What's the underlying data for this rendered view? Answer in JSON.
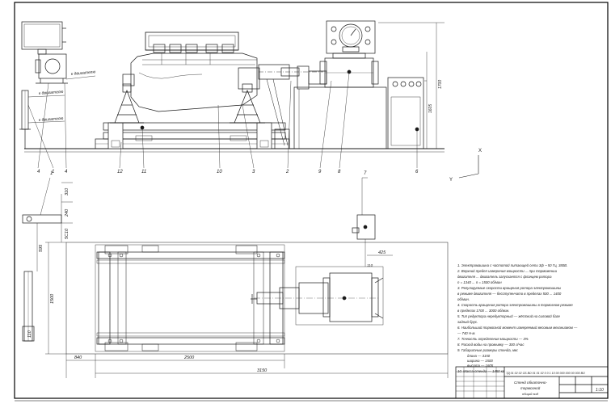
{
  "sheet": {
    "border_color": "#000000",
    "line_color": "#1a1a1a",
    "thin_color": "#555555"
  },
  "callouts": [
    "4",
    "1",
    "4",
    "12",
    "11",
    "10",
    "3",
    "2",
    "9",
    "8",
    "6",
    "7"
  ],
  "top_view_callouts": [
    "1",
    "7"
  ],
  "leader_notes": [
    "к двигателю",
    "к двигателю",
    "к двигателю"
  ],
  "dims": {
    "front_width": "1700",
    "front_height": "1605",
    "plan_total": "3150",
    "plan_frame": "2500",
    "plan_left": "840",
    "plan_depth": "1500",
    "top_small_a": "310",
    "top_small_b": "240",
    "top_small_c": "5С10",
    "left_small": "595",
    "left_block": "110",
    "right_small": "425",
    "right_small2": "110"
  },
  "axes": {
    "x": "X",
    "y": "Y"
  },
  "notes": [
    "1. Электромашина с частотой питающей сети 3ф ~ 50 Гц, 380В.",
    "2. Верхний предел измерения мощности ... при торможении",
    "двигателя ... двигатель запускается с фланцем ротора",
    "n = 1340 ... n = 1500 об/мин",
    "3. Регулируемые скорости вращения ротора электромашины",
    "в режиме двигателя — бесступенчато в пределах 500 ... 1400",
    "об/мин.",
    "4. Скорость вращения ротора электромашины в тормозном режиме",
    "в пределах 1700 ... 3000 об/мин.",
    "5. Тип редуктора нередукторный — жёсткий на силовой базе",
    "задний брус.",
    "6. Наибольший тормозной момент измеряемый весовым механизмом —",
    "— 740 Н·м.",
    "7. Точность определения мощности — 3%",
    "8. Расход воды на промывку — 300 л/час",
    "9. Габаритные размеры стенда, мм:",
    "длина — 3150",
    "ширина — 1500",
    "высота — 1605",
    "10. Масса стенда — 1450 кг"
  ],
  "title_block": {
    "code": "ТД 01 02 02 СБ ВО 01 01 02 0 0 1 10 00 000 000 00 000 ВО",
    "name_line1": "Стенд обкаточно-",
    "name_line2": "тормозной",
    "name_line3": "общий вид",
    "sheet_no": "1:10"
  }
}
